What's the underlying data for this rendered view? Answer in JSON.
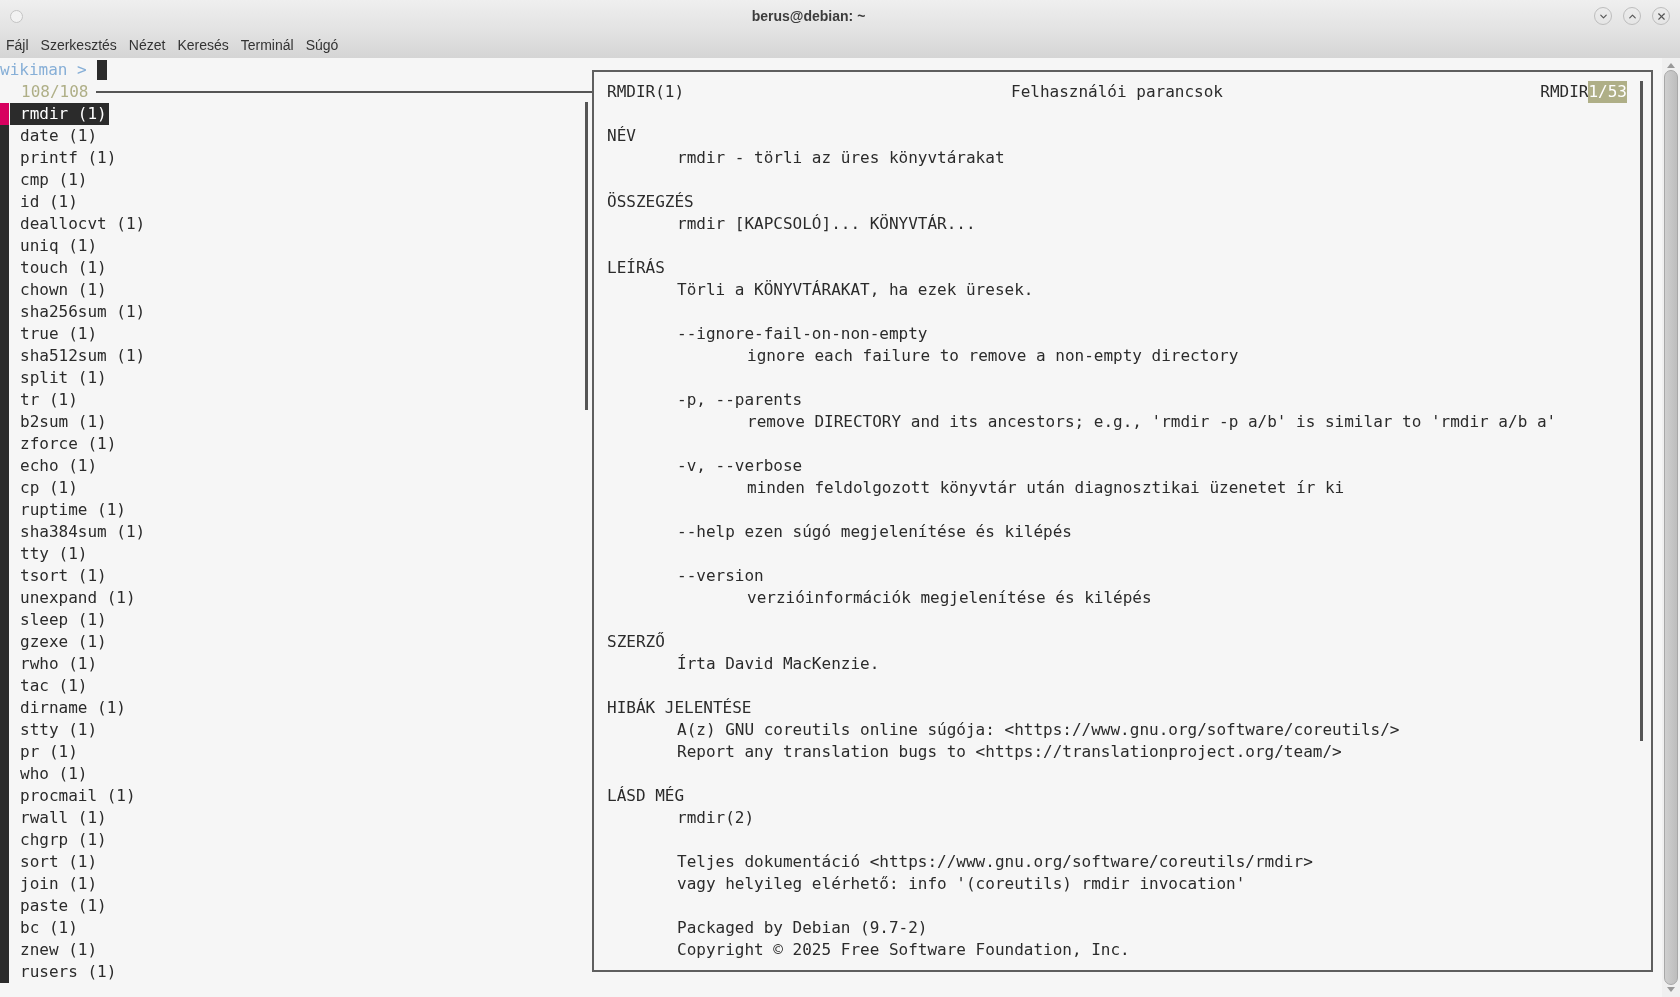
{
  "window": {
    "title": "berus@debian: ~"
  },
  "menu": [
    "Fájl",
    "Szerkesztés",
    "Nézet",
    "Keresés",
    "Terminál",
    "Súgó"
  ],
  "prompt": {
    "label": "wikiman >",
    "count": "108/108"
  },
  "results": [
    {
      "text": "rmdir (1)",
      "selected": true
    },
    {
      "text": "date (1)",
      "selected": false
    },
    {
      "text": "printf (1)",
      "selected": false
    },
    {
      "text": "cmp (1)",
      "selected": false
    },
    {
      "text": "id (1)",
      "selected": false
    },
    {
      "text": "deallocvt (1)",
      "selected": false
    },
    {
      "text": "uniq (1)",
      "selected": false
    },
    {
      "text": "touch (1)",
      "selected": false
    },
    {
      "text": "chown (1)",
      "selected": false
    },
    {
      "text": "sha256sum (1)",
      "selected": false
    },
    {
      "text": "true (1)",
      "selected": false
    },
    {
      "text": "sha512sum (1)",
      "selected": false
    },
    {
      "text": "split (1)",
      "selected": false
    },
    {
      "text": "tr (1)",
      "selected": false
    },
    {
      "text": "b2sum (1)",
      "selected": false
    },
    {
      "text": "zforce (1)",
      "selected": false
    },
    {
      "text": "echo (1)",
      "selected": false
    },
    {
      "text": "cp (1)",
      "selected": false
    },
    {
      "text": "ruptime (1)",
      "selected": false
    },
    {
      "text": "sha384sum (1)",
      "selected": false
    },
    {
      "text": "tty (1)",
      "selected": false
    },
    {
      "text": "tsort (1)",
      "selected": false
    },
    {
      "text": "unexpand (1)",
      "selected": false
    },
    {
      "text": "sleep (1)",
      "selected": false
    },
    {
      "text": "gzexe (1)",
      "selected": false
    },
    {
      "text": "rwho (1)",
      "selected": false
    },
    {
      "text": "tac (1)",
      "selected": false
    },
    {
      "text": "dirname (1)",
      "selected": false
    },
    {
      "text": "stty (1)",
      "selected": false
    },
    {
      "text": "pr (1)",
      "selected": false
    },
    {
      "text": "who (1)",
      "selected": false
    },
    {
      "text": "procmail (1)",
      "selected": false
    },
    {
      "text": "rwall (1)",
      "selected": false
    },
    {
      "text": "chgrp (1)",
      "selected": false
    },
    {
      "text": "sort (1)",
      "selected": false
    },
    {
      "text": "join (1)",
      "selected": false
    },
    {
      "text": "paste (1)",
      "selected": false
    },
    {
      "text": "bc (1)",
      "selected": false
    },
    {
      "text": "znew (1)",
      "selected": false
    },
    {
      "text": "rusers (1)",
      "selected": false
    }
  ],
  "man_page": {
    "header": {
      "left": "RMDIR(1)",
      "center": "Felhasználói parancsok",
      "right": "RMDIR",
      "position": "1/53"
    },
    "sections": [
      {
        "heading": "NÉV",
        "paragraphs": [
          [
            {
              "kind": "body",
              "text": "rmdir - törli az üres könyvtárakat"
            }
          ]
        ]
      },
      {
        "heading": "ÖSSZEGZÉS",
        "paragraphs": [
          [
            {
              "kind": "body",
              "text": "rmdir [KAPCSOLÓ]... KÖNYVTÁR..."
            }
          ]
        ]
      },
      {
        "heading": "LEÍRÁS",
        "paragraphs": [
          [
            {
              "kind": "body",
              "text": "Törli a KÖNYVTÁRAKAT, ha ezek üresek."
            }
          ],
          [
            {
              "kind": "body",
              "text": "--ignore-fail-on-non-empty"
            },
            {
              "kind": "detail",
              "text": "ignore each failure to remove a non-empty directory"
            }
          ],
          [
            {
              "kind": "body",
              "text": "-p, --parents"
            },
            {
              "kind": "detail",
              "text": "remove DIRECTORY and its ancestors; e.g., 'rmdir -p a/b' is similar to 'rmdir a/b a'"
            }
          ],
          [
            {
              "kind": "body",
              "text": "-v, --verbose"
            },
            {
              "kind": "detail",
              "text": "minden feldolgozott könyvtár után diagnosztikai üzenetet ír ki"
            }
          ],
          [
            {
              "kind": "body",
              "text": "--help ezen súgó megjelenítése és kilépés"
            }
          ],
          [
            {
              "kind": "body",
              "text": "--version"
            },
            {
              "kind": "detail",
              "text": "verzióinformációk megjelenítése és kilépés"
            }
          ]
        ]
      },
      {
        "heading": "SZERZŐ",
        "paragraphs": [
          [
            {
              "kind": "body",
              "text": "Írta David MacKenzie."
            }
          ]
        ]
      },
      {
        "heading": "HIBÁK JELENTÉSE",
        "paragraphs": [
          [
            {
              "kind": "body",
              "text": "A(z) GNU coreutils online súgója: <https://www.gnu.org/software/coreutils/>"
            },
            {
              "kind": "body",
              "text": "Report any translation bugs to <https://translationproject.org/team/>"
            }
          ]
        ]
      },
      {
        "heading": "LÁSD MÉG",
        "paragraphs": [
          [
            {
              "kind": "body",
              "text": "rmdir(2)"
            }
          ],
          [
            {
              "kind": "body",
              "text": "Teljes dokumentáció <https://www.gnu.org/software/coreutils/rmdir>"
            },
            {
              "kind": "body",
              "text": "vagy helyileg elérhető: info '(coreutils) rmdir invocation'"
            }
          ],
          [
            {
              "kind": "body",
              "text": "Packaged by Debian (9.7-2)"
            },
            {
              "kind": "body",
              "text": "Copyright © 2025 Free Software Foundation, Inc."
            }
          ]
        ]
      }
    ]
  }
}
